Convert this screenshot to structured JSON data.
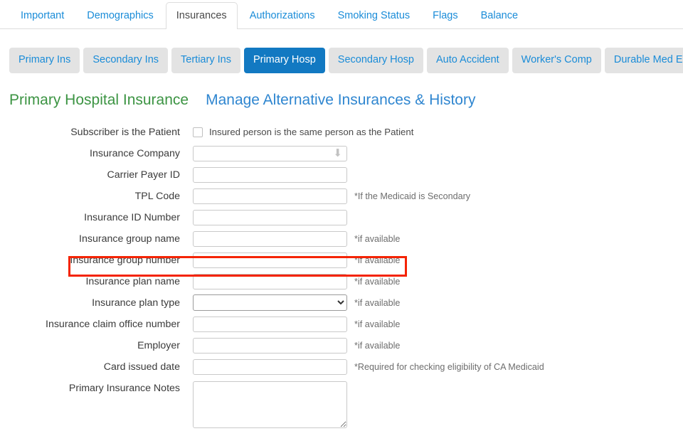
{
  "main_tabs": [
    {
      "label": "Important",
      "active": false
    },
    {
      "label": "Demographics",
      "active": false
    },
    {
      "label": "Insurances",
      "active": true
    },
    {
      "label": "Authorizations",
      "active": false
    },
    {
      "label": "Smoking Status",
      "active": false
    },
    {
      "label": "Flags",
      "active": false
    },
    {
      "label": "Balance",
      "active": false
    }
  ],
  "sub_tabs": [
    {
      "label": "Primary Ins",
      "active": false
    },
    {
      "label": "Secondary Ins",
      "active": false
    },
    {
      "label": "Tertiary Ins",
      "active": false
    },
    {
      "label": "Primary Hosp",
      "active": true
    },
    {
      "label": "Secondary Hosp",
      "active": false
    },
    {
      "label": "Auto Accident",
      "active": false
    },
    {
      "label": "Worker's Comp",
      "active": false
    },
    {
      "label": "Durable Med Eqpt",
      "active": false
    }
  ],
  "headings": {
    "section_title": "Primary Hospital Insurance",
    "manage_link": "Manage Alternative Insurances & History"
  },
  "form": {
    "subscriber": {
      "label": "Subscriber is the Patient",
      "checkbox_label": "Insured person is the same person as the Patient",
      "checked": false
    },
    "insurance_company": {
      "label": "Insurance Company",
      "value": "",
      "arrow_icon": "arrow-down-icon"
    },
    "carrier_payer_id": {
      "label": "Carrier Payer ID",
      "value": ""
    },
    "tpl_code": {
      "label": "TPL Code",
      "value": "",
      "hint": "*If the Medicaid is Secondary"
    },
    "insurance_id_number": {
      "label": "Insurance ID Number",
      "value": ""
    },
    "insurance_group_name": {
      "label": "Insurance group name",
      "value": "",
      "hint": "*if available"
    },
    "insurance_group_number": {
      "label": "Insurance group number",
      "value": "",
      "hint": "*if available",
      "highlighted": true
    },
    "insurance_plan_name": {
      "label": "Insurance plan name",
      "value": "",
      "hint": "*if available"
    },
    "insurance_plan_type": {
      "label": "Insurance plan type",
      "value": "",
      "hint": "*if available",
      "options": [
        ""
      ]
    },
    "insurance_claim_office_number": {
      "label": "Insurance claim office number",
      "value": "",
      "hint": "*if available"
    },
    "employer": {
      "label": "Employer",
      "value": "",
      "hint": "*if available"
    },
    "card_issued_date": {
      "label": "Card issued date",
      "value": "",
      "hint": "*Required for checking eligibility of CA Medicaid"
    },
    "primary_insurance_notes": {
      "label": "Primary Insurance Notes",
      "value": ""
    }
  },
  "colors": {
    "active_pill_bg": "#1279c2",
    "pill_bg": "#e3e3e3",
    "link_blue": "#1a8cd8",
    "heading_green": "#3c9443",
    "heading_blue": "#2f86d0",
    "highlight_red": "#f42300"
  }
}
